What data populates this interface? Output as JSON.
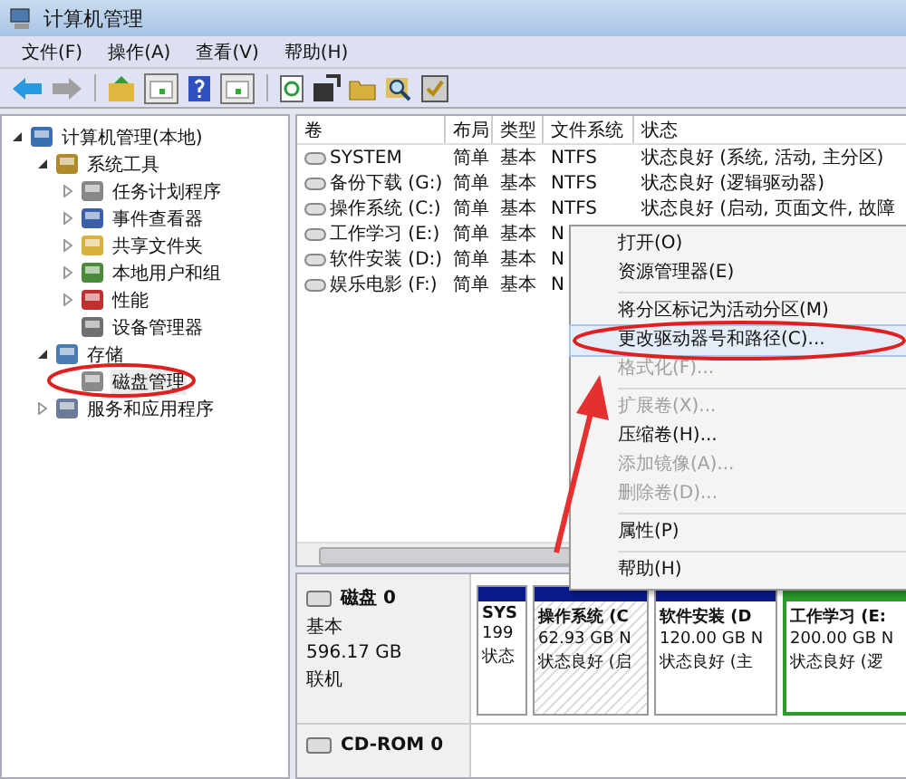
{
  "window": {
    "title": "计算机管理"
  },
  "menu": [
    "文件(F)",
    "操作(A)",
    "查看(V)",
    "帮助(H)"
  ],
  "tree": [
    {
      "label": "计算机管理(本地)",
      "expanded": true,
      "selected": false,
      "children": [
        {
          "label": "系统工具",
          "expanded": true,
          "selected": false,
          "children": [
            {
              "label": "任务计划程序",
              "expanded": false,
              "selected": false
            },
            {
              "label": "事件查看器",
              "expanded": false,
              "selected": false
            },
            {
              "label": "共享文件夹",
              "expanded": false,
              "selected": false
            },
            {
              "label": "本地用户和组",
              "expanded": false,
              "selected": false
            },
            {
              "label": "性能",
              "expanded": false,
              "selected": false
            },
            {
              "label": "设备管理器",
              "selected": false
            }
          ]
        },
        {
          "label": "存储",
          "expanded": true,
          "selected": false,
          "children": [
            {
              "label": "磁盘管理",
              "selected": true
            }
          ]
        },
        {
          "label": "服务和应用程序",
          "expanded": false,
          "selected": false
        }
      ]
    }
  ],
  "table": {
    "columns": [
      "卷",
      "布局",
      "类型",
      "文件系统",
      "状态"
    ],
    "rows": [
      {
        "cells": [
          "SYSTEM",
          "简单",
          "基本",
          "NTFS",
          "状态良好 (系统, 活动, 主分区)"
        ]
      },
      {
        "cells": [
          "备份下载 (G:)",
          "简单",
          "基本",
          "NTFS",
          "状态良好 (逻辑驱动器)"
        ]
      },
      {
        "cells": [
          "操作系统 (C:)",
          "简单",
          "基本",
          "NTFS",
          "状态良好 (启动, 页面文件, 故障"
        ]
      },
      {
        "cells": [
          "工作学习 (E:)",
          "简单",
          "基本",
          "N"
        ]
      },
      {
        "cells": [
          "软件安装 (D:)",
          "简单",
          "基本",
          "N"
        ]
      },
      {
        "cells": [
          "娱乐电影 (F:)",
          "简单",
          "基本",
          "N"
        ]
      }
    ]
  },
  "disks": [
    {
      "name": "磁盘 0",
      "lines": [
        "基本",
        "596.17 GB",
        "联机"
      ],
      "partitions": [
        {
          "lines": [
            "SYS",
            "199",
            "状态"
          ],
          "kind": "primary",
          "selected": false
        },
        {
          "lines": [
            "操作系统 (C",
            "62.93 GB N",
            "状态良好 (启"
          ],
          "kind": "primary",
          "selected": true
        },
        {
          "lines": [
            "软件安装 (D",
            "120.00 GB N",
            "状态良好 (主"
          ],
          "kind": "primary",
          "selected": false
        },
        {
          "lines": [
            "工作学习 (E:",
            "200.00 GB N",
            "状态良好 (逻"
          ],
          "kind": "logical",
          "selected": false
        }
      ]
    },
    {
      "name": "CD-ROM 0"
    }
  ],
  "context_menu": [
    {
      "label": "打开(O)",
      "kind": "item",
      "disabled": false,
      "selected": false
    },
    {
      "label": "资源管理器(E)",
      "kind": "item",
      "disabled": false,
      "selected": false
    },
    {
      "kind": "separator"
    },
    {
      "label": "将分区标记为活动分区(M)",
      "kind": "item",
      "disabled": false,
      "selected": false
    },
    {
      "label": "更改驱动器号和路径(C)...",
      "kind": "item",
      "disabled": false,
      "selected": true
    },
    {
      "label": "格式化(F)...",
      "kind": "item",
      "disabled": true,
      "selected": false
    },
    {
      "kind": "separator"
    },
    {
      "label": "扩展卷(X)...",
      "kind": "item",
      "disabled": true,
      "selected": false
    },
    {
      "label": "压缩卷(H)...",
      "kind": "item",
      "disabled": false,
      "selected": false
    },
    {
      "label": "添加镜像(A)...",
      "kind": "item",
      "disabled": true,
      "selected": false
    },
    {
      "label": "删除卷(D)...",
      "kind": "item",
      "disabled": true,
      "selected": false
    },
    {
      "kind": "separator"
    },
    {
      "label": "属性(P)",
      "kind": "item",
      "disabled": false,
      "selected": false
    },
    {
      "kind": "separator"
    },
    {
      "label": "帮助(H)",
      "kind": "item",
      "disabled": false,
      "selected": false
    }
  ]
}
